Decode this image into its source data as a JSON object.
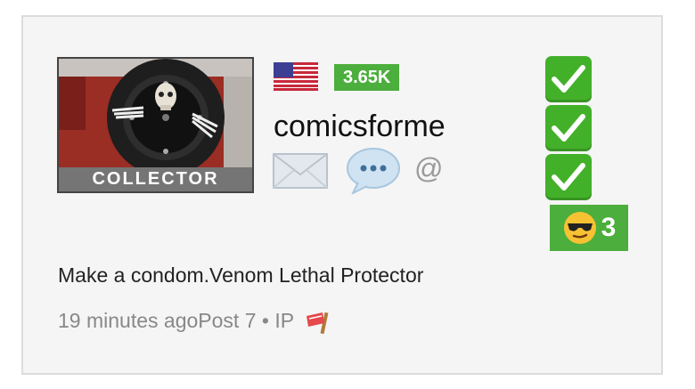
{
  "user": {
    "role_badge": "COLLECTOR",
    "country_flag": "us-flag-icon",
    "reputation": "3.65K",
    "username": "comicsforme",
    "contact_icons": [
      "mail-icon",
      "chat-bubble-icon",
      "at-sign-icon"
    ],
    "at_symbol": "@"
  },
  "badges": {
    "checkmarks": [
      "check-icon",
      "check-icon",
      "check-icon"
    ],
    "emoji_icon": "sunglasses-emoji-icon",
    "emoji_count": "3"
  },
  "post": {
    "title": "Make a condom.Venom Lethal Protector",
    "time": "19 minutes ago",
    "post_number": "Post 7",
    "separator": "•",
    "ip_label": "IP",
    "report_icon": "report-flag-icon"
  },
  "colors": {
    "accent_green": "#4cae3c",
    "check_green": "#43b02a",
    "role_badge_bg": "#757575"
  }
}
